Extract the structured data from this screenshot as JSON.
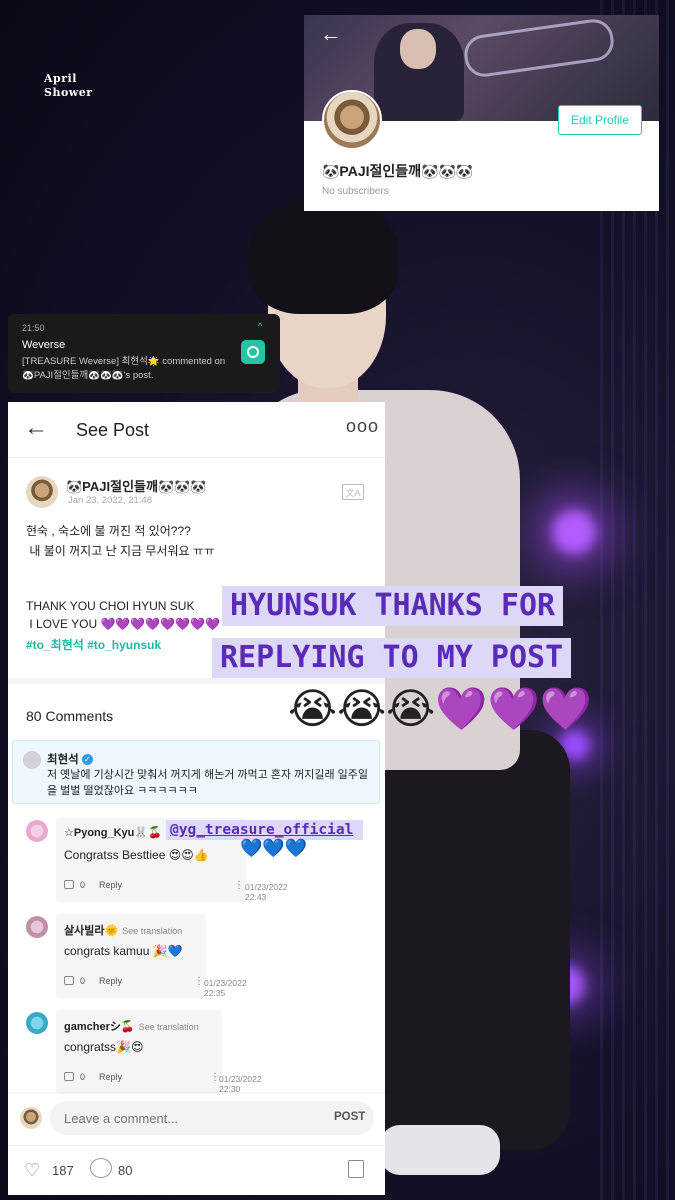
{
  "logo": {
    "line1": "April",
    "line2": "Shower"
  },
  "profile_card": {
    "back_icon": "arrow-left-icon",
    "edit_button": "Edit Profile",
    "name": "🐼PAJI절인들깨🐼🐼🐼",
    "subscribers": "No subscribers"
  },
  "notification": {
    "time": "21:50",
    "app": "Weverse",
    "body": "[TREASURE Weverse] 최현석🌟 commented on 🐼PAJI절인들깨🐼🐼🐼's post."
  },
  "post": {
    "header_title": "See Post",
    "more_icon": "ooo",
    "author": "🐼PAJI절인들깨🐼🐼🐼",
    "date": "Jan 23, 2022, 21:48",
    "translate_icon": "translate-icon",
    "lines": [
      "현숙 , 숙소에 불 꺼진 적 있어???",
      " 내 불이 꺼지고 난 지금 무서워요 ㅠㅠ",
      "THANK YOU CHOI HYUN SUK",
      " I LOVE YOU 💜💜💜💜💜💜💜💜"
    ],
    "hashtags": "#to_최현석 #to_hyunsuk",
    "comments_label": "80 Comments"
  },
  "pinned_comment": {
    "name": "최현석",
    "text": "저 옛날에 기상시간 맞춰서 꺼지게 해논거 까먹고 혼자 꺼지길래 일주일을 벌벌 떨었잖아요 ㅋㅋㅋㅋㅋㅋ"
  },
  "comments": [
    {
      "name": "☆Pyong_Kyu🐰🍒",
      "see_translation": "",
      "text": "Congratss Besttiee 😍😍👍",
      "likes": "0",
      "reply": "Reply",
      "date": "01/23/2022",
      "time": "22:43"
    },
    {
      "name": "살사빌라🌞",
      "see_translation": "See translation",
      "text": "congrats kamuu 🎉💙",
      "likes": "0",
      "reply": "Reply",
      "date": "01/23/2022",
      "time": "22:35"
    },
    {
      "name": "gamcherシ🍒",
      "see_translation": "See translation",
      "text": "congratss🎉😍",
      "likes": "0",
      "reply": "Reply",
      "date": "01/23/2022",
      "time": "22:30"
    }
  ],
  "comment_bar": {
    "placeholder": "Leave a comment...",
    "post_label": "POST"
  },
  "bottom_bar": {
    "likes": "187",
    "comments": "80"
  },
  "caption": {
    "line1": "HYUNSUK THANKS FOR",
    "line2": "REPLYING TO MY POST",
    "emoji": "😭😭😭💜💜💜",
    "mention": "@yg_treasure_official",
    "mention_hearts": "💙💙💙"
  },
  "colors": {
    "accent": "#23c7b9",
    "caption_bg": "#ded8f8",
    "caption_text": "#5a2bb6",
    "verified": "#2f9be8"
  }
}
